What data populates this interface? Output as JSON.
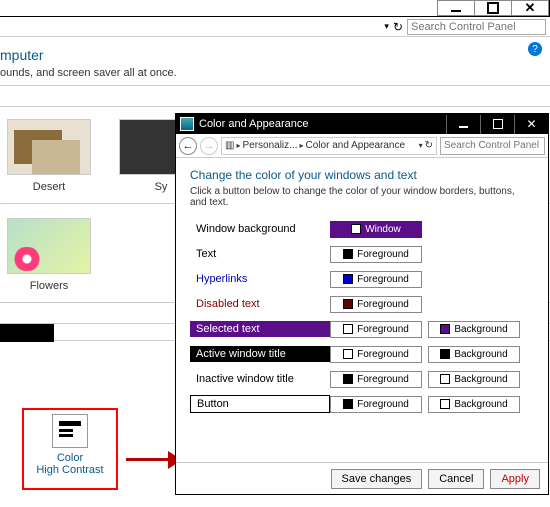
{
  "parent": {
    "search_placeholder": "Search Control Panel",
    "title_suffix": "mputer",
    "subtitle_suffix": "ounds, and screen saver all at once.",
    "themes_row1": [
      {
        "id": "desert",
        "label": "Desert"
      },
      {
        "id": "sy",
        "label": "Sy"
      }
    ],
    "themes_row2": [
      {
        "id": "flowers",
        "label": "Flowers"
      }
    ],
    "hc_tile": {
      "line1": "Color",
      "line2": "High Contrast"
    }
  },
  "dialog": {
    "title": "Color and Appearance",
    "breadcrumb": [
      "Personaliz...",
      "Color and Appearance"
    ],
    "search_placeholder": "Search Control Panel",
    "heading": "Change the color of your windows and text",
    "sub": "Click a button below to change the color of your window borders, buttons, and text.",
    "rows": [
      {
        "label": "Window background",
        "style": "norm",
        "buttons": [
          {
            "text": "Window",
            "sw": "#fff",
            "bg": "#5a0e8a",
            "fg": "#fff"
          }
        ]
      },
      {
        "label": "Text",
        "style": "norm",
        "buttons": [
          {
            "text": "Foreground",
            "sw": "#000"
          }
        ]
      },
      {
        "label": "Hyperlinks",
        "style": "hyper",
        "buttons": [
          {
            "text": "Foreground",
            "sw": "#0000cc"
          }
        ]
      },
      {
        "label": "Disabled text",
        "style": "disabled",
        "buttons": [
          {
            "text": "Foreground",
            "sw": "#600000"
          }
        ]
      },
      {
        "label": "Selected text",
        "style": "selected",
        "buttons": [
          {
            "text": "Foreground",
            "sw": "#fff"
          },
          {
            "text": "Background",
            "sw": "#5a0e8a"
          }
        ]
      },
      {
        "label": "Active window title",
        "style": "active",
        "buttons": [
          {
            "text": "Foreground",
            "sw": "#fff"
          },
          {
            "text": "Background",
            "sw": "#000"
          }
        ]
      },
      {
        "label": "Inactive window title",
        "style": "inactive",
        "buttons": [
          {
            "text": "Foreground",
            "sw": "#000"
          },
          {
            "text": "Background",
            "sw": "#fff"
          }
        ]
      },
      {
        "label": "Button",
        "style": "button",
        "buttons": [
          {
            "text": "Foreground",
            "sw": "#000"
          },
          {
            "text": "Background",
            "sw": "#fff"
          }
        ]
      }
    ],
    "footer": {
      "save": "Save changes",
      "cancel": "Cancel",
      "apply": "Apply"
    }
  }
}
